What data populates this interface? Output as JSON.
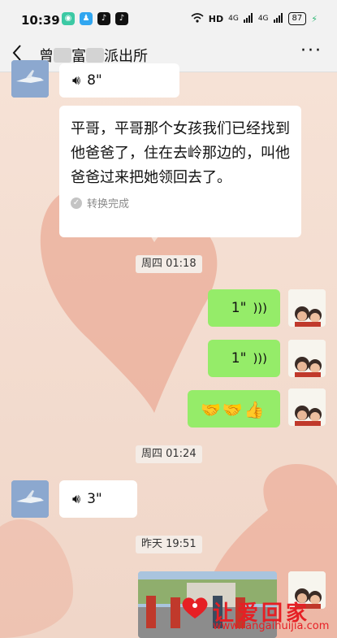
{
  "status_bar": {
    "time": "10:39",
    "network_label": "HD",
    "signal_1": "4G",
    "signal_2": "4G",
    "battery": "87"
  },
  "nav": {
    "title_part1": "曾",
    "title_part2": "富",
    "title_part3": "派出所"
  },
  "messages": {
    "m1_voice": "8\"",
    "m2_text": "平哥，平哥那个女孩我们已经找到他爸爸了，住在去岭那边的，叫他爸爸过来把她领回去了。",
    "m2_convert": "转换完成",
    "ts1": "周四 01:18",
    "m3_voice": "1\"",
    "m4_voice": "1\"",
    "m5_emoji": "🤝🤝👍",
    "ts2": "周四 01:24",
    "m6_voice": "3\"",
    "ts3": "昨天 19:51"
  },
  "watermark": {
    "text": "让爱回家",
    "url": "www.rangaihuijia.com"
  }
}
